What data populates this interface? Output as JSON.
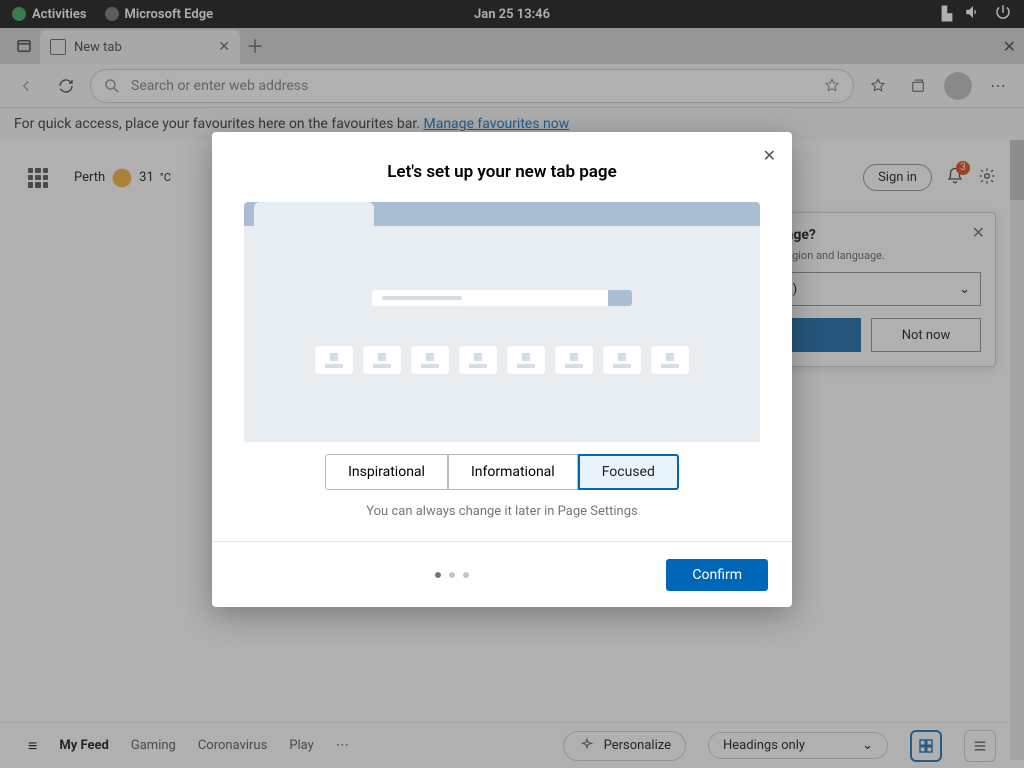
{
  "system": {
    "activities": "Activities",
    "app": "Microsoft Edge",
    "clock": "Jan 25  13:46"
  },
  "tab": {
    "title": "New tab"
  },
  "addr": {
    "placeholder": "Search or enter web address"
  },
  "fav": {
    "text": "For quick access, place your favourites here on the favourites bar.  ",
    "link": "Manage favourites now"
  },
  "weather": {
    "city": "Perth",
    "temp": "31",
    "unit": "°C"
  },
  "signin": "Sign in",
  "notif": {
    "count": "3"
  },
  "lang": {
    "title": "language?",
    "subtitle": "ferred region and language.",
    "selected": "iglish)",
    "notnow": "Not now"
  },
  "modal": {
    "title": "Let's set up your new tab page",
    "opts": [
      "Inspirational",
      "Informational",
      "Focused"
    ],
    "selected": 2,
    "hint": "You can always change it later in Page Settings",
    "confirm": "Confirm",
    "page": 0,
    "pages": 3
  },
  "feed": {
    "items": [
      "My Feed",
      "Gaming",
      "Coronavirus",
      "Play"
    ],
    "personalize": "Personalize",
    "view": "Headings only"
  },
  "hamburger": "≡"
}
